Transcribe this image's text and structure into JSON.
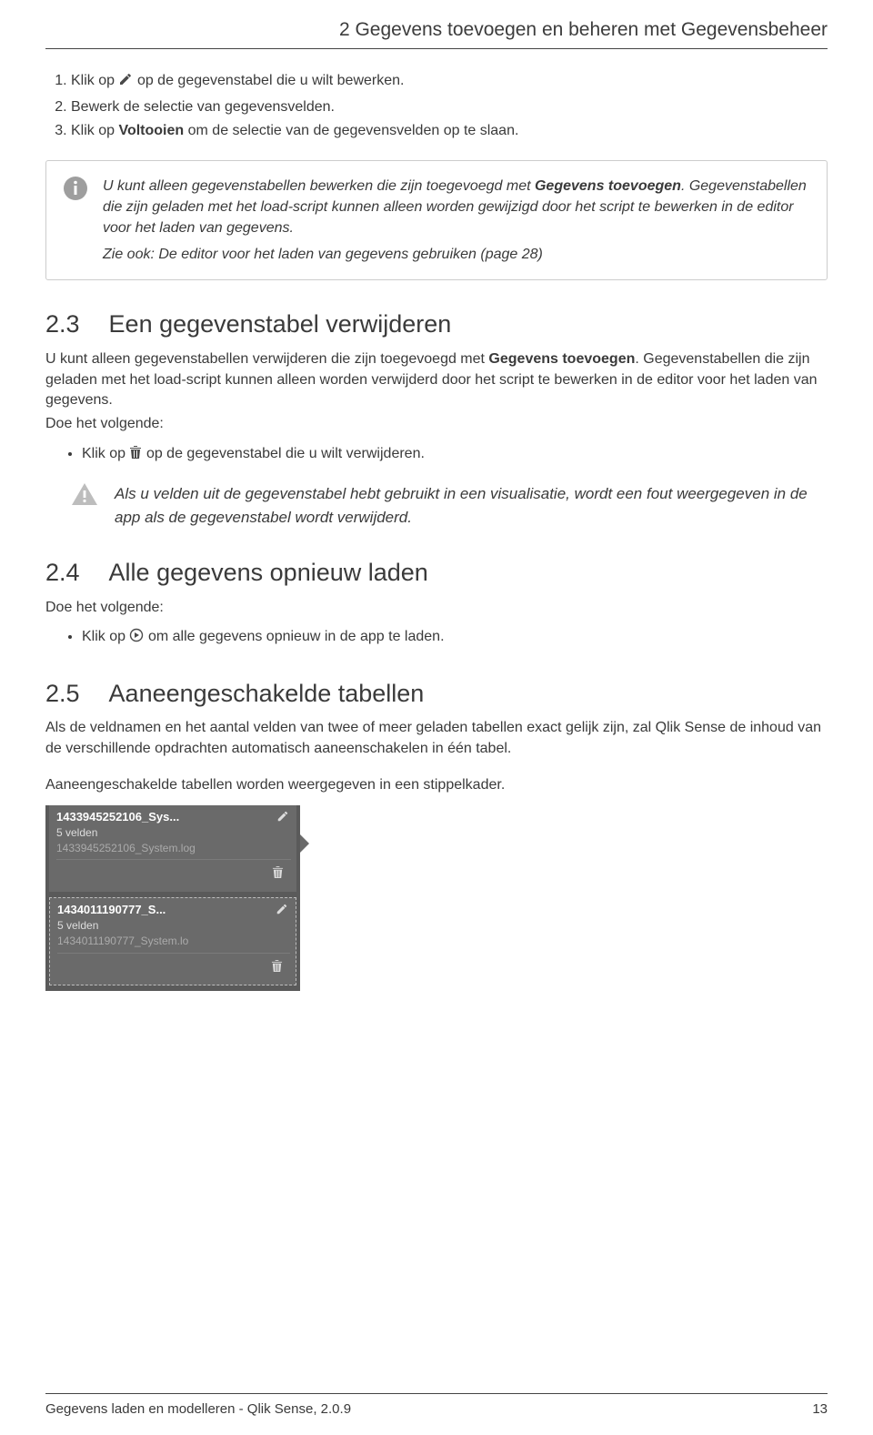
{
  "header": {
    "running_title": "2   Gegevens toevoegen en beheren met Gegevensbeheer"
  },
  "steps": {
    "s1_a": "Klik op",
    "s1_b": "op de gegevenstabel die u wilt bewerken.",
    "s2": "Bewerk de selectie van gegevensvelden.",
    "s3_a": "Klik op ",
    "s3_bold": "Voltooien",
    "s3_b": " om de selectie van de gegevensvelden op te slaan."
  },
  "note": {
    "line1_a": "U kunt alleen gegevenstabellen bewerken die zijn toegevoegd met ",
    "line1_bold": "Gegevens toevoegen",
    "line1_b": ". Gegevenstabellen die zijn geladen met het load-script kunnen alleen worden gewijzigd door het script te bewerken in de editor voor het laden van gegevens.",
    "line2": "Zie ook: De editor voor het laden van gegevens gebruiken (page 28)"
  },
  "sec23": {
    "num": "2.3",
    "title": "Een gegevenstabel verwijderen",
    "p1_a": "U kunt alleen gegevenstabellen verwijderen die zijn toegevoegd met ",
    "p1_bold": "Gegevens toevoegen",
    "p1_b": ". Gegevenstabellen die zijn geladen met het load-script kunnen alleen worden verwijderd door het script te bewerken in de editor voor het laden van gegevens.",
    "p2": "Doe het volgende:",
    "bullet_a": "Klik op",
    "bullet_b": "op de gegevenstabel die u wilt verwijderen."
  },
  "warning": {
    "text": "Als u velden uit de gegevenstabel hebt gebruikt in een visualisatie, wordt een fout weergegeven in de app als de gegevenstabel wordt verwijderd."
  },
  "sec24": {
    "num": "2.4",
    "title": "Alle gegevens opnieuw laden",
    "p1": "Doe het volgende:",
    "bullet_a": "Klik op",
    "bullet_b": "om alle gegevens opnieuw in de app te laden."
  },
  "sec25": {
    "num": "2.5",
    "title": "Aaneengeschakelde tabellen",
    "p1": "Als de veldnamen en het aantal velden van twee of meer geladen tabellen exact gelijk zijn, zal Qlik Sense de inhoud van de verschillende opdrachten automatisch aaneenschakelen in één tabel.",
    "p2": "Aaneengeschakelde tabellen worden weergegeven in een stippelkader."
  },
  "panel": {
    "card1": {
      "title": "1433945252106_Sys...",
      "sub": "5 velden",
      "file": "1433945252106_System.log"
    },
    "card2": {
      "title": "1434011190777_S...",
      "sub": "5 velden",
      "file": "1434011190777_System.lo"
    }
  },
  "footer": {
    "left": "Gegevens laden en modelleren - Qlik Sense, 2.0.9",
    "right": "13"
  }
}
